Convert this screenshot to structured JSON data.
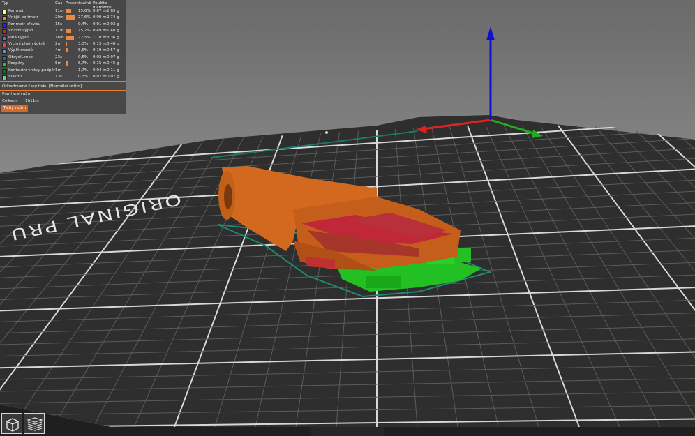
{
  "legend": {
    "headers": {
      "type": "Typ",
      "time": "Čas",
      "percent": "Procentuálně",
      "filament": "Použito filamentu"
    },
    "rows": [
      {
        "name": "Perimetr",
        "time": "11m",
        "pct": "15,6%",
        "len": "0,87 m",
        "wt": "2,65 g",
        "color": "#ffff66",
        "share": 0.156
      },
      {
        "name": "Vnější perimetr",
        "time": "20m",
        "pct": "27,6%",
        "len": "0,90 m",
        "wt": "2,74 g",
        "color": "#ff7d38",
        "share": 0.276
      },
      {
        "name": "Perimetr převisu",
        "time": "15s",
        "pct": "0,4%",
        "len": "0,01 m",
        "wt": "0,03 g",
        "color": "#1f1fff",
        "share": 0.004
      },
      {
        "name": "Vnitřní výplň",
        "time": "11m",
        "pct": "15,7%",
        "len": "0,49 m",
        "wt": "1,48 g",
        "color": "#b03029",
        "share": 0.157
      },
      {
        "name": "Plná výplň",
        "time": "16m",
        "pct": "22,5%",
        "len": "1,10 m",
        "wt": "3,36 g",
        "color": "#9654cc",
        "share": 0.225
      },
      {
        "name": "Vrchní plné výplně",
        "time": "2m",
        "pct": "3,3%",
        "len": "0,13 m",
        "wt": "0,40 g",
        "color": "#f04040",
        "share": 0.033
      },
      {
        "name": "Výplň mostů",
        "time": "4m",
        "pct": "5,6%",
        "len": "0,19 m",
        "wt": "0,57 g",
        "color": "#6b8fd6",
        "share": 0.056
      },
      {
        "name": "Obrys/Limec",
        "time": "23s",
        "pct": "0,5%",
        "len": "0,02 m",
        "wt": "0,07 g",
        "color": "#00877b",
        "share": 0.005
      },
      {
        "name": "Podpěry",
        "time": "5m",
        "pct": "6,7%",
        "len": "0,15 m",
        "wt": "0,45 g",
        "color": "#22d022",
        "share": 0.067
      },
      {
        "name": "Kontaktní vrstvy podpěr",
        "time": "1m",
        "pct": "1,7%",
        "len": "0,04 m",
        "wt": "0,11 g",
        "color": "#008000",
        "share": 0.017
      },
      {
        "name": "Vlastní",
        "time": "13s",
        "pct": "0,3%",
        "len": "0,02 m",
        "wt": "0,07 g",
        "color": "#5ed6a2",
        "share": 0.003
      }
    ],
    "estimate_title": "Odhadované časy tisku [Normální režim]:",
    "first_layer_label": "První vrstva:",
    "first_layer_value": "3m",
    "total_label": "Celkem:",
    "total_value": "1h11m",
    "mode_button": "Tichý režim"
  },
  "bed": {
    "text": "ORIGINAL PRU"
  },
  "colors": {
    "background": "#8a8a8a",
    "bed": "#2e2e2e",
    "grid": "#5a5a5a",
    "accent": "#d2692c"
  }
}
